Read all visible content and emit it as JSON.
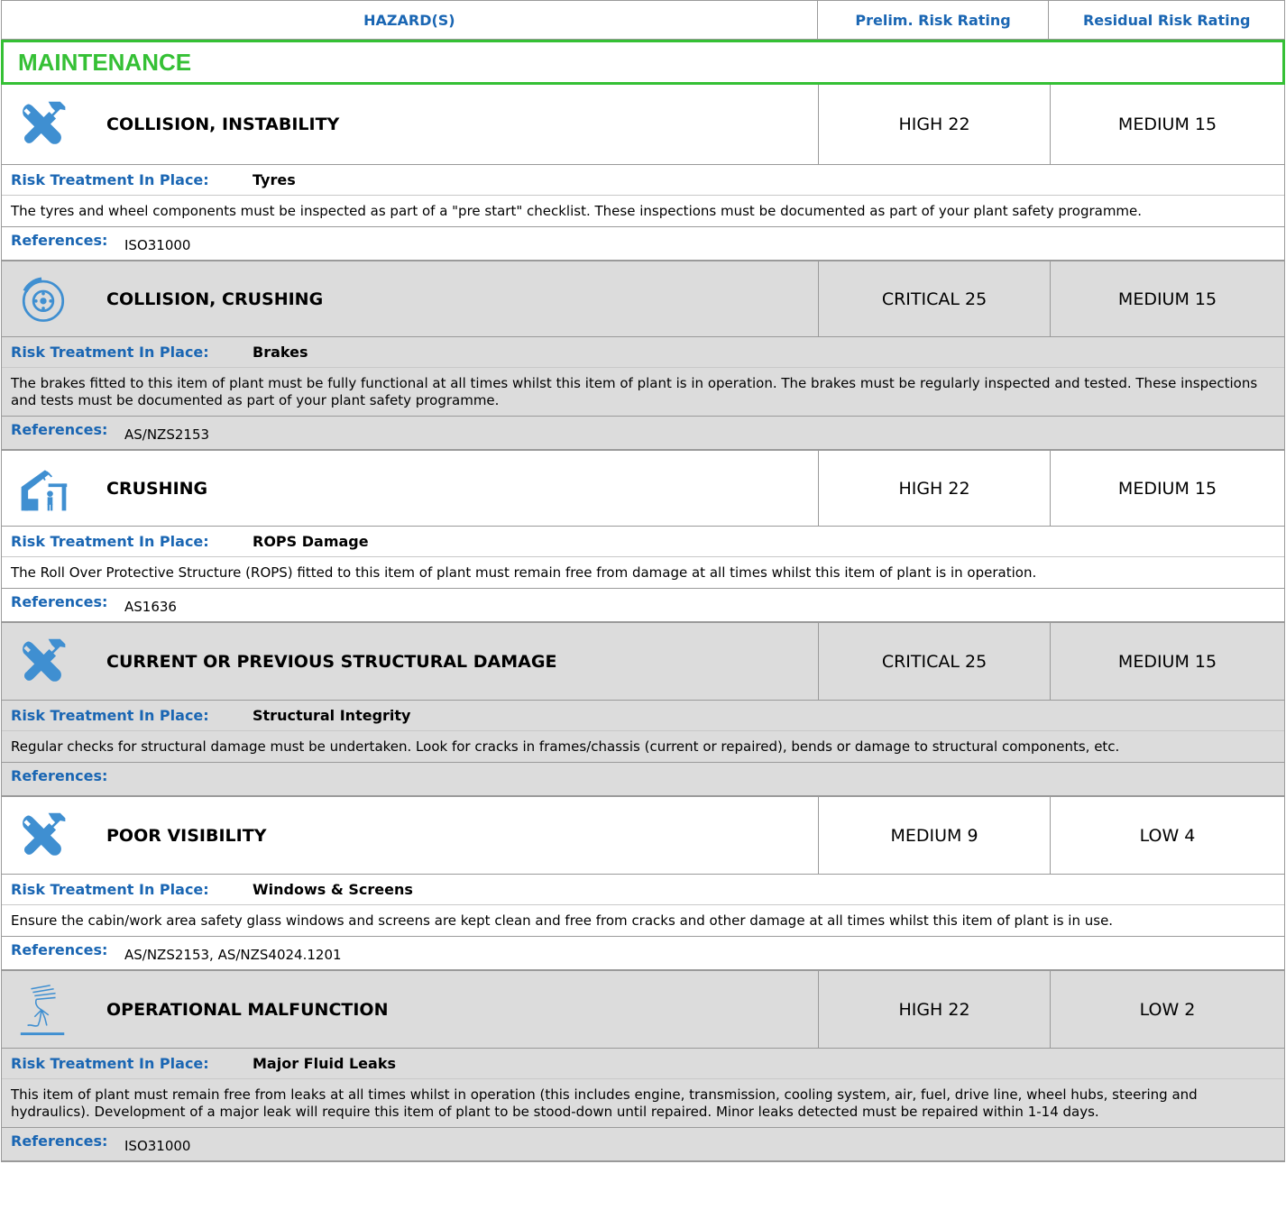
{
  "header": {
    "hazards": "HAZARD(S)",
    "prelim": "Prelim. Risk Rating",
    "residual": "Residual Risk Rating"
  },
  "section": {
    "title": "MAINTENANCE"
  },
  "labels": {
    "treatment": "Risk Treatment In Place:",
    "references": "References:"
  },
  "hazards": [
    {
      "icon": "wrench-hammer-icon",
      "name": "COLLISION, INSTABILITY",
      "prelim": "HIGH 22",
      "residual": "MEDIUM 15",
      "treatment": "Tyres",
      "description": "The tyres and wheel components must be inspected as part of a \"pre start\" checklist. These inspections must be documented as part of your plant safety programme.",
      "references": "ISO31000"
    },
    {
      "icon": "brake-disc-icon",
      "name": "COLLISION, CRUSHING",
      "prelim": "CRITICAL 25",
      "residual": "MEDIUM 15",
      "treatment": "Brakes",
      "description": "The brakes fitted to this item of plant must be fully functional at all times whilst this item of plant is in operation. The brakes must be regularly inspected and tested. These inspections and tests must be documented as part of your plant safety programme.",
      "references": "AS/NZS2153"
    },
    {
      "icon": "rops-crush-icon",
      "name": "CRUSHING",
      "prelim": "HIGH 22",
      "residual": "MEDIUM 15",
      "treatment": "ROPS Damage",
      "description": "The Roll Over Protective Structure (ROPS) fitted to this item of plant must remain free from damage at all times whilst this item of plant is in operation.",
      "references": "AS1636"
    },
    {
      "icon": "wrench-hammer-icon",
      "name": "CURRENT OR PREVIOUS STRUCTURAL DAMAGE",
      "prelim": "CRITICAL 25",
      "residual": "MEDIUM 15",
      "treatment": "Structural Integrity",
      "description": "Regular checks for structural damage must be undertaken. Look for cracks in frames/chassis (current or repaired), bends or damage to structural components, etc.",
      "references": ""
    },
    {
      "icon": "wrench-hammer-icon",
      "name": "POOR VISIBILITY",
      "prelim": "MEDIUM 9",
      "residual": "LOW 4",
      "treatment": "Windows & Screens",
      "description": "Ensure the cabin/work area safety glass windows and screens are kept clean and free from cracks and other damage at all times whilst this item of plant is in use.",
      "references": "AS/NZS2153, AS/NZS4024.1201"
    },
    {
      "icon": "fluid-leak-icon",
      "name": "OPERATIONAL MALFUNCTION",
      "prelim": "HIGH 22",
      "residual": "LOW 2",
      "treatment": "Major Fluid Leaks",
      "description": "This item of plant must remain free from leaks at all times whilst in operation (this includes engine, transmission, cooling system, air, fuel, drive line, wheel hubs, steering and hydraulics). Development of a major leak will require this item of plant to be stood-down until repaired. Minor leaks detected must be repaired within 1-14 days.",
      "references": "ISO31000"
    }
  ],
  "colors": {
    "accent_blue": "#1a66b3",
    "section_green": "#35c035",
    "shade": "#dcdcdc",
    "icon_blue": "#3f8fd1"
  }
}
